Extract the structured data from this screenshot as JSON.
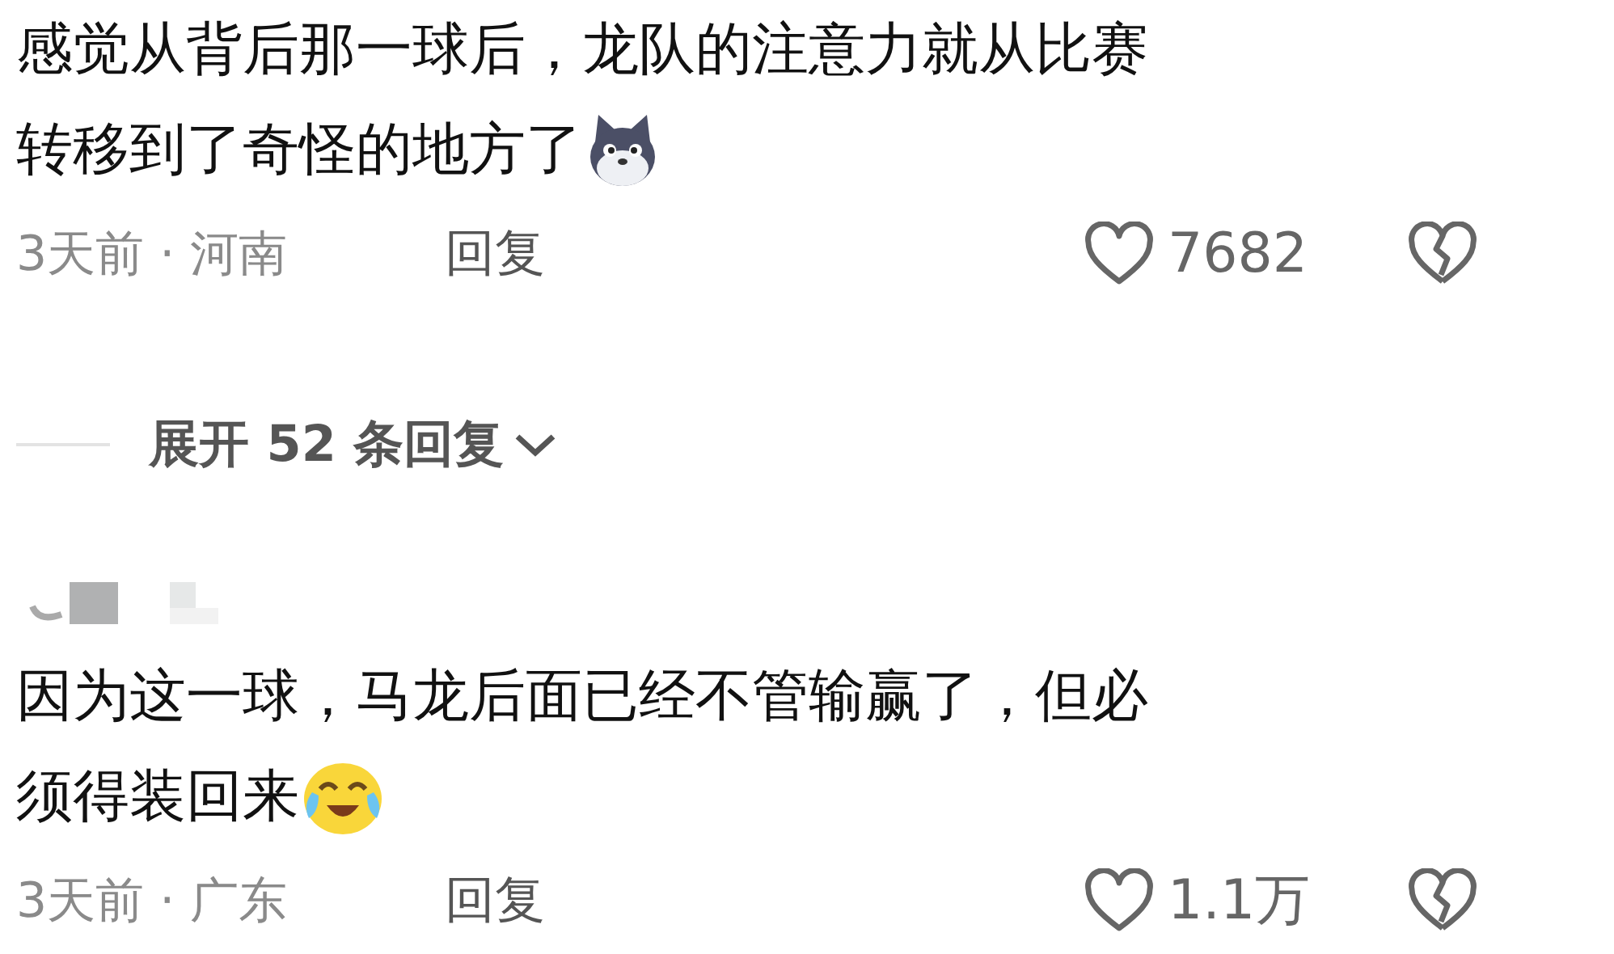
{
  "comments": [
    {
      "emoji": {
        "kind": "wolf"
      },
      "lines": [
        "感觉从背后那一球后，龙队的注意力就从比赛",
        "转移到了奇怪的地方了"
      ],
      "time": "3天前 · 河南",
      "reply": "回复",
      "likes": "7682",
      "liked": false
    },
    {
      "user": {
        "kind": "blurred"
      },
      "emoji": {
        "kind": "laugh-cry"
      },
      "lines": [
        "因为这一球，马龙后面已经不管输赢了，但必",
        "须得装回来"
      ],
      "time": "3天前 · 广东",
      "reply": "回复",
      "likes": "1.1万",
      "liked": false
    }
  ],
  "expand": {
    "label": "展开 52 条回复"
  }
}
